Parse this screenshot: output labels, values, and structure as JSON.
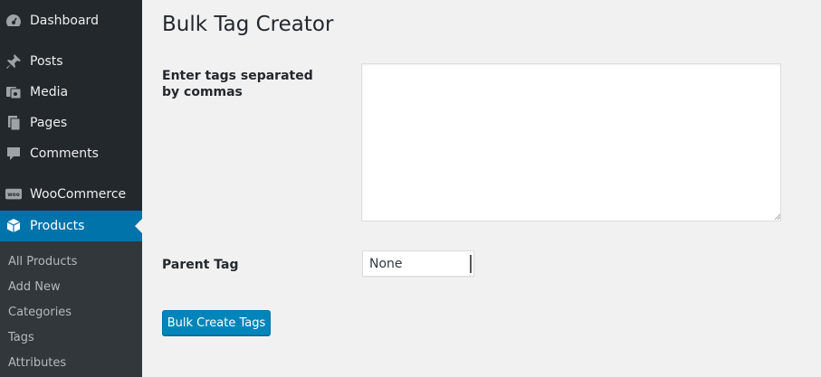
{
  "sidebar": {
    "items": [
      {
        "label": "Dashboard",
        "icon": "dashboard-icon"
      },
      {
        "label": "Posts",
        "icon": "pin-icon"
      },
      {
        "label": "Media",
        "icon": "media-icon"
      },
      {
        "label": "Pages",
        "icon": "pages-icon"
      },
      {
        "label": "Comments",
        "icon": "comment-icon"
      },
      {
        "label": "WooCommerce",
        "icon": "woo-icon",
        "icon_text": "woo"
      },
      {
        "label": "Products",
        "icon": "box-icon",
        "active": true
      }
    ],
    "submenu": [
      {
        "label": "All Products"
      },
      {
        "label": "Add New"
      },
      {
        "label": "Categories"
      },
      {
        "label": "Tags"
      },
      {
        "label": "Attributes"
      }
    ]
  },
  "main": {
    "title": "Bulk Tag Creator",
    "tags_field": {
      "label": "Enter tags separated by commas",
      "value": ""
    },
    "parent_field": {
      "label": "Parent Tag",
      "selected": "None"
    },
    "submit_label": "Bulk Create Tags"
  },
  "colors": {
    "sidebar_bg": "#23282d",
    "submenu_bg": "#32373c",
    "active": "#0073aa",
    "button": "#0085ba"
  }
}
